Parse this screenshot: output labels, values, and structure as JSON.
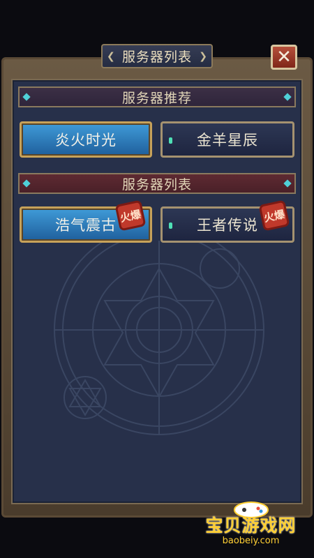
{
  "dialog": {
    "title": "服务器列表",
    "close_label": "✕"
  },
  "recommended": {
    "header": "服务器推荐",
    "servers": [
      {
        "name": "炎火时光",
        "selected": true
      },
      {
        "name": "金羊星辰",
        "selected": false
      }
    ]
  },
  "server_list": {
    "header": "服务器列表",
    "servers": [
      {
        "name": "浩气震古",
        "selected": true,
        "badge": "火爆"
      },
      {
        "name": "王者传说",
        "selected": false,
        "badge": "火爆"
      }
    ]
  },
  "watermark": {
    "title": "宝贝游戏网",
    "url": "baobeiy.com"
  },
  "colors": {
    "panel_bg": "#27304a",
    "active_button": "#2f7fc0",
    "gold_border": "#c7a25a",
    "hot_badge": "#c0392b"
  },
  "icons": {
    "close": "close-icon",
    "indicator": "status-dot-icon"
  }
}
